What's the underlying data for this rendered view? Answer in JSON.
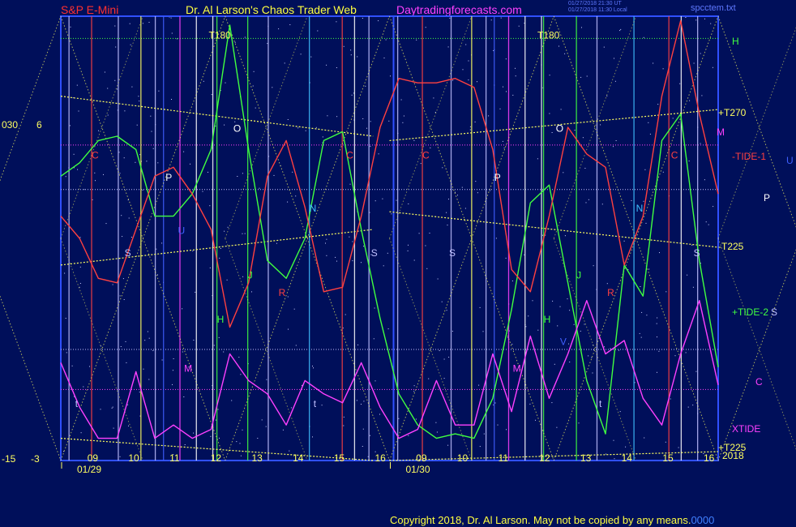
{
  "header": {
    "instrument": "S&P E-Mini",
    "site": "Dr. Al Larson's Chaos Trader Web",
    "url": "Daytradingforecasts.com",
    "stamp_line1": "01/27/2018 21:30 UT",
    "stamp_line2": "01/27/2018 11:30 Local",
    "file": "spcctem.txt"
  },
  "footer": {
    "copyright": "Copyright 2018, Dr. Al Larson. May not be copied by any means.",
    "tag": "0000"
  },
  "left_axis": {
    "top_labels": [
      "030",
      "6"
    ],
    "bottom_labels": [
      "-15",
      "-3"
    ]
  },
  "right_labels": [
    {
      "text": "H",
      "color": "#40ff40"
    },
    {
      "text": "+T270",
      "color": "#ffff60"
    },
    {
      "text": "M",
      "color": "#ff40ff"
    },
    {
      "text": "-TIDE-1",
      "color": "#ff4040"
    },
    {
      "text": "U",
      "color": "#4060ff"
    },
    {
      "text": "P",
      "color": "#ffffff"
    },
    {
      "text": "-T225",
      "color": "#ffff60"
    },
    {
      "text": "+TIDE-2",
      "color": "#40ff40"
    },
    {
      "text": "S",
      "color": "#c0c0ff"
    },
    {
      "text": "C",
      "color": "#ff40ff"
    },
    {
      "text": "XTIDE",
      "color": "#ff40ff"
    },
    {
      "text": "+T225",
      "color": "#ffff60"
    },
    {
      "text": "2018",
      "color": "#ffff60"
    }
  ],
  "chart_data": {
    "type": "line",
    "days": [
      "01/29",
      "01/30"
    ],
    "hour_ticks": [
      "09",
      "10",
      "11",
      "12",
      "13",
      "14",
      "15",
      "16",
      "09",
      "10",
      "11",
      "12",
      "13",
      "14",
      "15",
      "16"
    ],
    "series": [
      {
        "name": "+TIDE-2",
        "color": "#40ff40",
        "values": [
          0.64,
          0.67,
          0.72,
          0.73,
          0.7,
          0.55,
          0.55,
          0.6,
          0.7,
          0.98,
          0.7,
          0.45,
          0.41,
          0.5,
          0.72,
          0.74,
          0.52,
          0.32,
          0.15,
          0.08,
          0.05,
          0.06,
          0.05,
          0.14,
          0.34,
          0.58,
          0.62,
          0.4,
          0.18,
          0.06,
          0.44,
          0.37,
          0.72,
          0.78,
          0.45,
          0.21
        ]
      },
      {
        "name": "-TIDE-1",
        "color": "#ff4040",
        "values": [
          0.55,
          0.5,
          0.41,
          0.4,
          0.52,
          0.64,
          0.66,
          0.6,
          0.52,
          0.3,
          0.4,
          0.64,
          0.72,
          0.57,
          0.38,
          0.39,
          0.55,
          0.75,
          0.86,
          0.85,
          0.85,
          0.86,
          0.84,
          0.7,
          0.43,
          0.38,
          0.55,
          0.75,
          0.69,
          0.66,
          0.44,
          0.55,
          0.82,
          0.99,
          0.78,
          0.6
        ]
      },
      {
        "name": "XTIDE",
        "color": "#ff40ff",
        "values": [
          0.22,
          0.12,
          0.05,
          0.05,
          0.2,
          0.05,
          0.08,
          0.05,
          0.07,
          0.24,
          0.18,
          0.15,
          0.08,
          0.18,
          0.15,
          0.13,
          0.22,
          0.12,
          0.05,
          0.07,
          0.18,
          0.08,
          0.08,
          0.24,
          0.11,
          0.28,
          0.14,
          0.24,
          0.36,
          0.24,
          0.27,
          0.14,
          0.08,
          0.24,
          0.36,
          0.17
        ]
      }
    ],
    "markers": [
      {
        "text": "T180",
        "x": 3.6,
        "y": 0.95,
        "color": "#ffff60"
      },
      {
        "text": "T180",
        "x": 11.6,
        "y": 0.95,
        "color": "#ffff60"
      },
      {
        "text": "C",
        "x": 0.75,
        "y": 0.68,
        "color": "#ff4040"
      },
      {
        "text": "P",
        "x": 2.55,
        "y": 0.63,
        "color": "#ffffff"
      },
      {
        "text": "O",
        "x": 4.2,
        "y": 0.74,
        "color": "#ffffff"
      },
      {
        "text": "U",
        "x": 2.85,
        "y": 0.51,
        "color": "#4060ff"
      },
      {
        "text": "S",
        "x": 1.55,
        "y": 0.46,
        "color": "#c0c0ff"
      },
      {
        "text": "J",
        "x": 4.55,
        "y": 0.41,
        "color": "#40ff40"
      },
      {
        "text": "R",
        "x": 5.3,
        "y": 0.37,
        "color": "#ff4040"
      },
      {
        "text": "H",
        "x": 3.8,
        "y": 0.31,
        "color": "#40ff40"
      },
      {
        "text": "M",
        "x": 3.0,
        "y": 0.2,
        "color": "#ff40ff"
      },
      {
        "text": "N",
        "x": 6.05,
        "y": 0.56,
        "color": "#40c0ff"
      },
      {
        "text": "C",
        "x": 6.95,
        "y": 0.68,
        "color": "#ff4040"
      },
      {
        "text": "S",
        "x": 7.55,
        "y": 0.46,
        "color": "#c0c0ff"
      },
      {
        "text": "t",
        "x": 0.35,
        "y": 0.12,
        "color": "#c0c0ff"
      },
      {
        "text": "t",
        "x": 6.15,
        "y": 0.12,
        "color": "#c0c0ff"
      },
      {
        "text": "C",
        "x": 8.8,
        "y": 0.68,
        "color": "#ff4040"
      },
      {
        "text": "S",
        "x": 9.45,
        "y": 0.46,
        "color": "#c0c0ff"
      },
      {
        "text": "P",
        "x": 10.55,
        "y": 0.63,
        "color": "#ffffff"
      },
      {
        "text": "O",
        "x": 12.05,
        "y": 0.74,
        "color": "#ffffff"
      },
      {
        "text": "H",
        "x": 11.75,
        "y": 0.31,
        "color": "#40ff40"
      },
      {
        "text": "M",
        "x": 11.0,
        "y": 0.2,
        "color": "#ff40ff"
      },
      {
        "text": "V",
        "x": 12.15,
        "y": 0.26,
        "color": "#4060ff"
      },
      {
        "text": "J",
        "x": 12.55,
        "y": 0.41,
        "color": "#40ff40"
      },
      {
        "text": "R",
        "x": 13.3,
        "y": 0.37,
        "color": "#ff4040"
      },
      {
        "text": "N",
        "x": 14.0,
        "y": 0.56,
        "color": "#40c0ff"
      },
      {
        "text": "C",
        "x": 14.85,
        "y": 0.68,
        "color": "#ff4040"
      },
      {
        "text": "S",
        "x": 15.4,
        "y": 0.46,
        "color": "#c0c0ff"
      },
      {
        "text": "t",
        "x": 13.1,
        "y": 0.12,
        "color": "#c0c0ff"
      }
    ],
    "vertical_lines": [
      {
        "x": 0.2,
        "color": "#c0c0ff"
      },
      {
        "x": 0.75,
        "color": "#ff4040"
      },
      {
        "x": 1.4,
        "color": "#c0c0ff"
      },
      {
        "x": 1.95,
        "color": "#ffff60"
      },
      {
        "x": 2.3,
        "color": "#c0c0ff"
      },
      {
        "x": 2.5,
        "color": "#4060ff"
      },
      {
        "x": 2.9,
        "color": "#ff40ff"
      },
      {
        "x": 3.3,
        "color": "#ffffff"
      },
      {
        "x": 3.7,
        "color": "#ffffff"
      },
      {
        "x": 3.8,
        "color": "#40ff40"
      },
      {
        "x": 4.55,
        "color": "#40ff40"
      },
      {
        "x": 5.05,
        "color": "#c0c0ff"
      },
      {
        "x": 6.05,
        "color": "#40c0ff"
      },
      {
        "x": 6.85,
        "color": "#ff4040"
      },
      {
        "x": 7.15,
        "color": "#ffffff"
      },
      {
        "x": 7.5,
        "color": "#c0c0ff"
      },
      {
        "x": 8.2,
        "color": "#c0c0ff"
      },
      {
        "x": 8.8,
        "color": "#ff4040"
      },
      {
        "x": 9.5,
        "color": "#c0c0ff"
      },
      {
        "x": 10.0,
        "color": "#ffff60"
      },
      {
        "x": 10.35,
        "color": "#c0c0ff"
      },
      {
        "x": 10.55,
        "color": "#4060ff"
      },
      {
        "x": 10.9,
        "color": "#ff40ff"
      },
      {
        "x": 11.3,
        "color": "#ffffff"
      },
      {
        "x": 11.7,
        "color": "#ffffff"
      },
      {
        "x": 11.75,
        "color": "#40ff40"
      },
      {
        "x": 12.55,
        "color": "#40ff40"
      },
      {
        "x": 13.05,
        "color": "#c0c0ff"
      },
      {
        "x": 13.95,
        "color": "#40c0ff"
      },
      {
        "x": 14.8,
        "color": "#ff4040"
      },
      {
        "x": 15.1,
        "color": "#ffffff"
      },
      {
        "x": 15.5,
        "color": "#c0c0ff"
      }
    ],
    "horizontal_lines": [
      {
        "y": 0.95,
        "color": "#40ff40"
      },
      {
        "y": 0.71,
        "color": "#ff40ff"
      },
      {
        "y": 0.61,
        "color": "#c0c0ff"
      },
      {
        "y": 0.25,
        "color": "#c0c0ff"
      },
      {
        "y": 0.16,
        "color": "#ff40ff"
      }
    ],
    "trend_lines": [
      {
        "x1": 0,
        "y1": 0.82,
        "x2": 7.6,
        "y2": 0.73,
        "color": "#ffff60"
      },
      {
        "x1": 0,
        "y1": 0.44,
        "x2": 7.6,
        "y2": 0.52,
        "color": "#ffff60"
      },
      {
        "x1": 8.0,
        "y1": 0.72,
        "x2": 16.0,
        "y2": 0.79,
        "color": "#ffff60"
      },
      {
        "x1": 8.0,
        "y1": 0.56,
        "x2": 16.0,
        "y2": 0.48,
        "color": "#ffff60"
      },
      {
        "x1": 0,
        "y1": 0.05,
        "x2": 7.6,
        "y2": 0.0,
        "color": "#ffff60"
      },
      {
        "x1": 8.0,
        "y1": 0.0,
        "x2": 16.0,
        "y2": 0.02,
        "color": "#ffff60"
      }
    ],
    "diamond_period": 4.0,
    "xlim": [
      0,
      16
    ],
    "ylim": [
      0,
      1
    ]
  }
}
